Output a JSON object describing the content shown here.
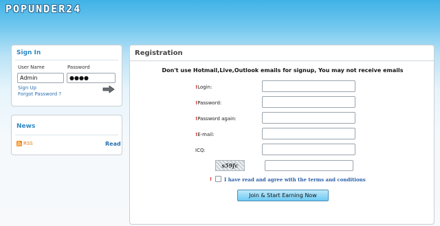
{
  "brand": {
    "logo_text": "POPUNDER24"
  },
  "signin": {
    "title": "Sign In",
    "user_label": "User Name",
    "password_label": "Password",
    "user_value": "Admin",
    "password_value": "●●●●",
    "signup_label": "Sign Up",
    "forgot_label": "Forgot Password ?",
    "submit_icon": "arrow-right-icon"
  },
  "news": {
    "title": "News",
    "rss_label": "RSS",
    "read_label": "Read"
  },
  "registration": {
    "title": "Registration",
    "notice": "Don't use Hotmail,Live,Outlook emails for signup, You may not receive emails",
    "required_mark": "!",
    "fields": [
      {
        "label": "Login:",
        "required": true
      },
      {
        "label": "Password:",
        "required": true
      },
      {
        "label": "Password again:",
        "required": true
      },
      {
        "label": "E-mail:",
        "required": true
      },
      {
        "label": "ICQ:",
        "required": false
      }
    ],
    "captcha_text": "s59fc",
    "agree_text": "I have read and agree with the terms and conditions",
    "submit_label": "Join & Start Earning Now"
  },
  "colors": {
    "header_top": "#3fb2e6",
    "title_blue": "#2f87c4",
    "link_blue": "#2a6fb0",
    "required_red": "#d21f1f",
    "rss_orange": "#e07a15"
  }
}
